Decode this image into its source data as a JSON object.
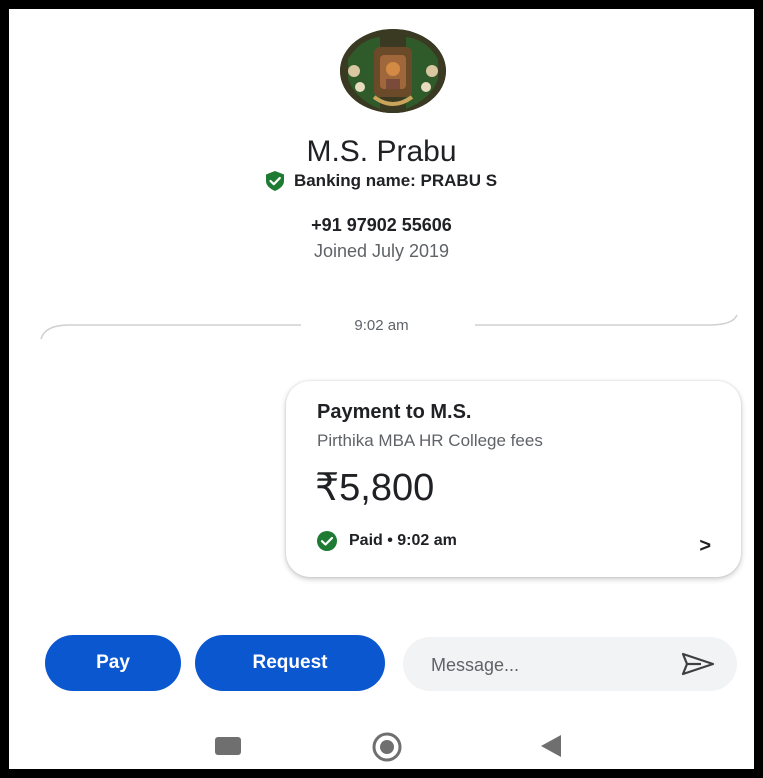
{
  "contact": {
    "name": "M.S. Prabu",
    "banking_name": "Banking name: PRABU S",
    "phone": "+91 97902 55606",
    "joined": "Joined July 2019",
    "avatar_icon": "profile-photo-icon"
  },
  "conversation": {
    "timestamp": "9:02 am"
  },
  "payment_card": {
    "title": "Payment to M.S.",
    "note": "Pirthika MBA HR College fees",
    "amount": "₹5,800",
    "status": "Paid • 9:02 am",
    "status_icon": "check-circle-icon",
    "chevron": ">"
  },
  "actions": {
    "pay_label": "Pay",
    "request_label": "Request",
    "message_placeholder": "Message...",
    "send_icon": "send-icon"
  },
  "nav": {
    "recents_icon": "square-icon",
    "home_icon": "circle-icon",
    "back_icon": "triangle-back-icon"
  },
  "colors": {
    "primary": "#0b57d0",
    "verified_green": "#1e7b34",
    "text": "#202124",
    "muted": "#5f6368"
  }
}
